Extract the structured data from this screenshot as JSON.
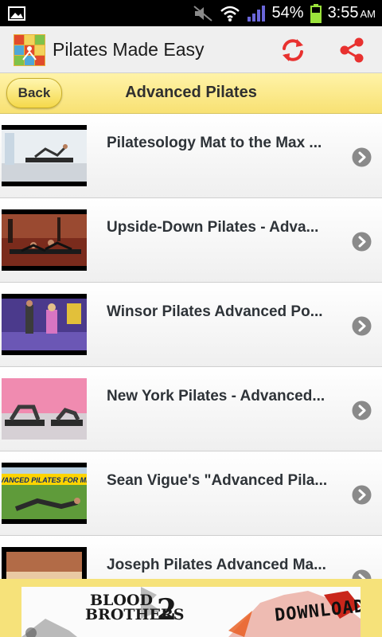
{
  "status_bar": {
    "battery": "54%",
    "time": "3:55",
    "ampm": "AM"
  },
  "action_bar": {
    "title": "Pilates Made Easy",
    "icons": [
      "app-logo-icon",
      "refresh-icon",
      "share-icon"
    ],
    "accent_color": "#e8312f"
  },
  "header": {
    "back_label": "Back",
    "title": "Advanced Pilates"
  },
  "list": {
    "items": [
      {
        "title": "Pilatesology Mat to the Max ..."
      },
      {
        "title": "Upside-Down Pilates - Adva..."
      },
      {
        "title": "Winsor Pilates Advanced Po..."
      },
      {
        "title": "New York Pilates - Advanced..."
      },
      {
        "title": "Sean Vigue's \"Advanced Pila..."
      },
      {
        "title": "Joseph Pilates Advanced Ma..."
      }
    ]
  },
  "thumb_texts": {
    "sean": "ADVANCED PILATES FOR MEN!"
  },
  "ad": {
    "line1": "BLOOD",
    "line2": "BROTHERS",
    "number": "2",
    "cta": "DOWNLOAD"
  },
  "colors": {
    "header_yellow": "#f8e173",
    "chevron": "#8a8a8a"
  }
}
